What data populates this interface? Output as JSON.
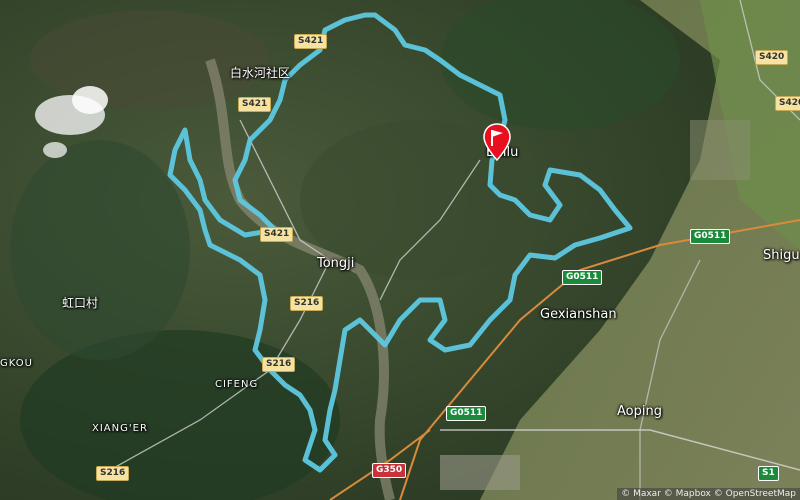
{
  "map": {
    "places": [
      {
        "id": "baishuihe",
        "label": "白水河社区"
      },
      {
        "id": "bailu",
        "label": "Bailu"
      },
      {
        "id": "tongji",
        "label": "Tongji"
      },
      {
        "id": "hongkou",
        "label": "虹口村"
      },
      {
        "id": "gexianshan",
        "label": "Gexianshan"
      },
      {
        "id": "cifeng",
        "label": "CIFENG"
      },
      {
        "id": "xiangeer",
        "label": "XIANG'ER"
      },
      {
        "id": "aoping",
        "label": "Aoping"
      },
      {
        "id": "shigu",
        "label": "Shigu"
      },
      {
        "id": "gkou",
        "label": "GKOU"
      }
    ],
    "road_shields": [
      {
        "id": "s421-a",
        "label": "S421",
        "type": "provincial"
      },
      {
        "id": "s421-b",
        "label": "S421",
        "type": "provincial"
      },
      {
        "id": "s421-c",
        "label": "S421",
        "type": "provincial"
      },
      {
        "id": "s420-a",
        "label": "S420",
        "type": "provincial"
      },
      {
        "id": "s420-b",
        "label": "S420",
        "type": "provincial"
      },
      {
        "id": "s216-a",
        "label": "S216",
        "type": "provincial"
      },
      {
        "id": "s216-b",
        "label": "S216",
        "type": "provincial"
      },
      {
        "id": "s216-c",
        "label": "S216",
        "type": "provincial"
      },
      {
        "id": "g0511-a",
        "label": "G0511",
        "type": "expressway"
      },
      {
        "id": "g0511-b",
        "label": "G0511",
        "type": "expressway"
      },
      {
        "id": "g0511-c",
        "label": "G0511",
        "type": "expressway"
      },
      {
        "id": "g350",
        "label": "G350",
        "type": "national"
      },
      {
        "id": "s1",
        "label": "S1",
        "type": "expressway"
      }
    ],
    "route": {
      "color": "#5ec8e0"
    },
    "marker": {
      "type": "flag-pin",
      "color": "#e8101e",
      "icon": "flag-icon"
    },
    "attribution": "© Maxar © Mapbox © OpenStreetMap"
  }
}
